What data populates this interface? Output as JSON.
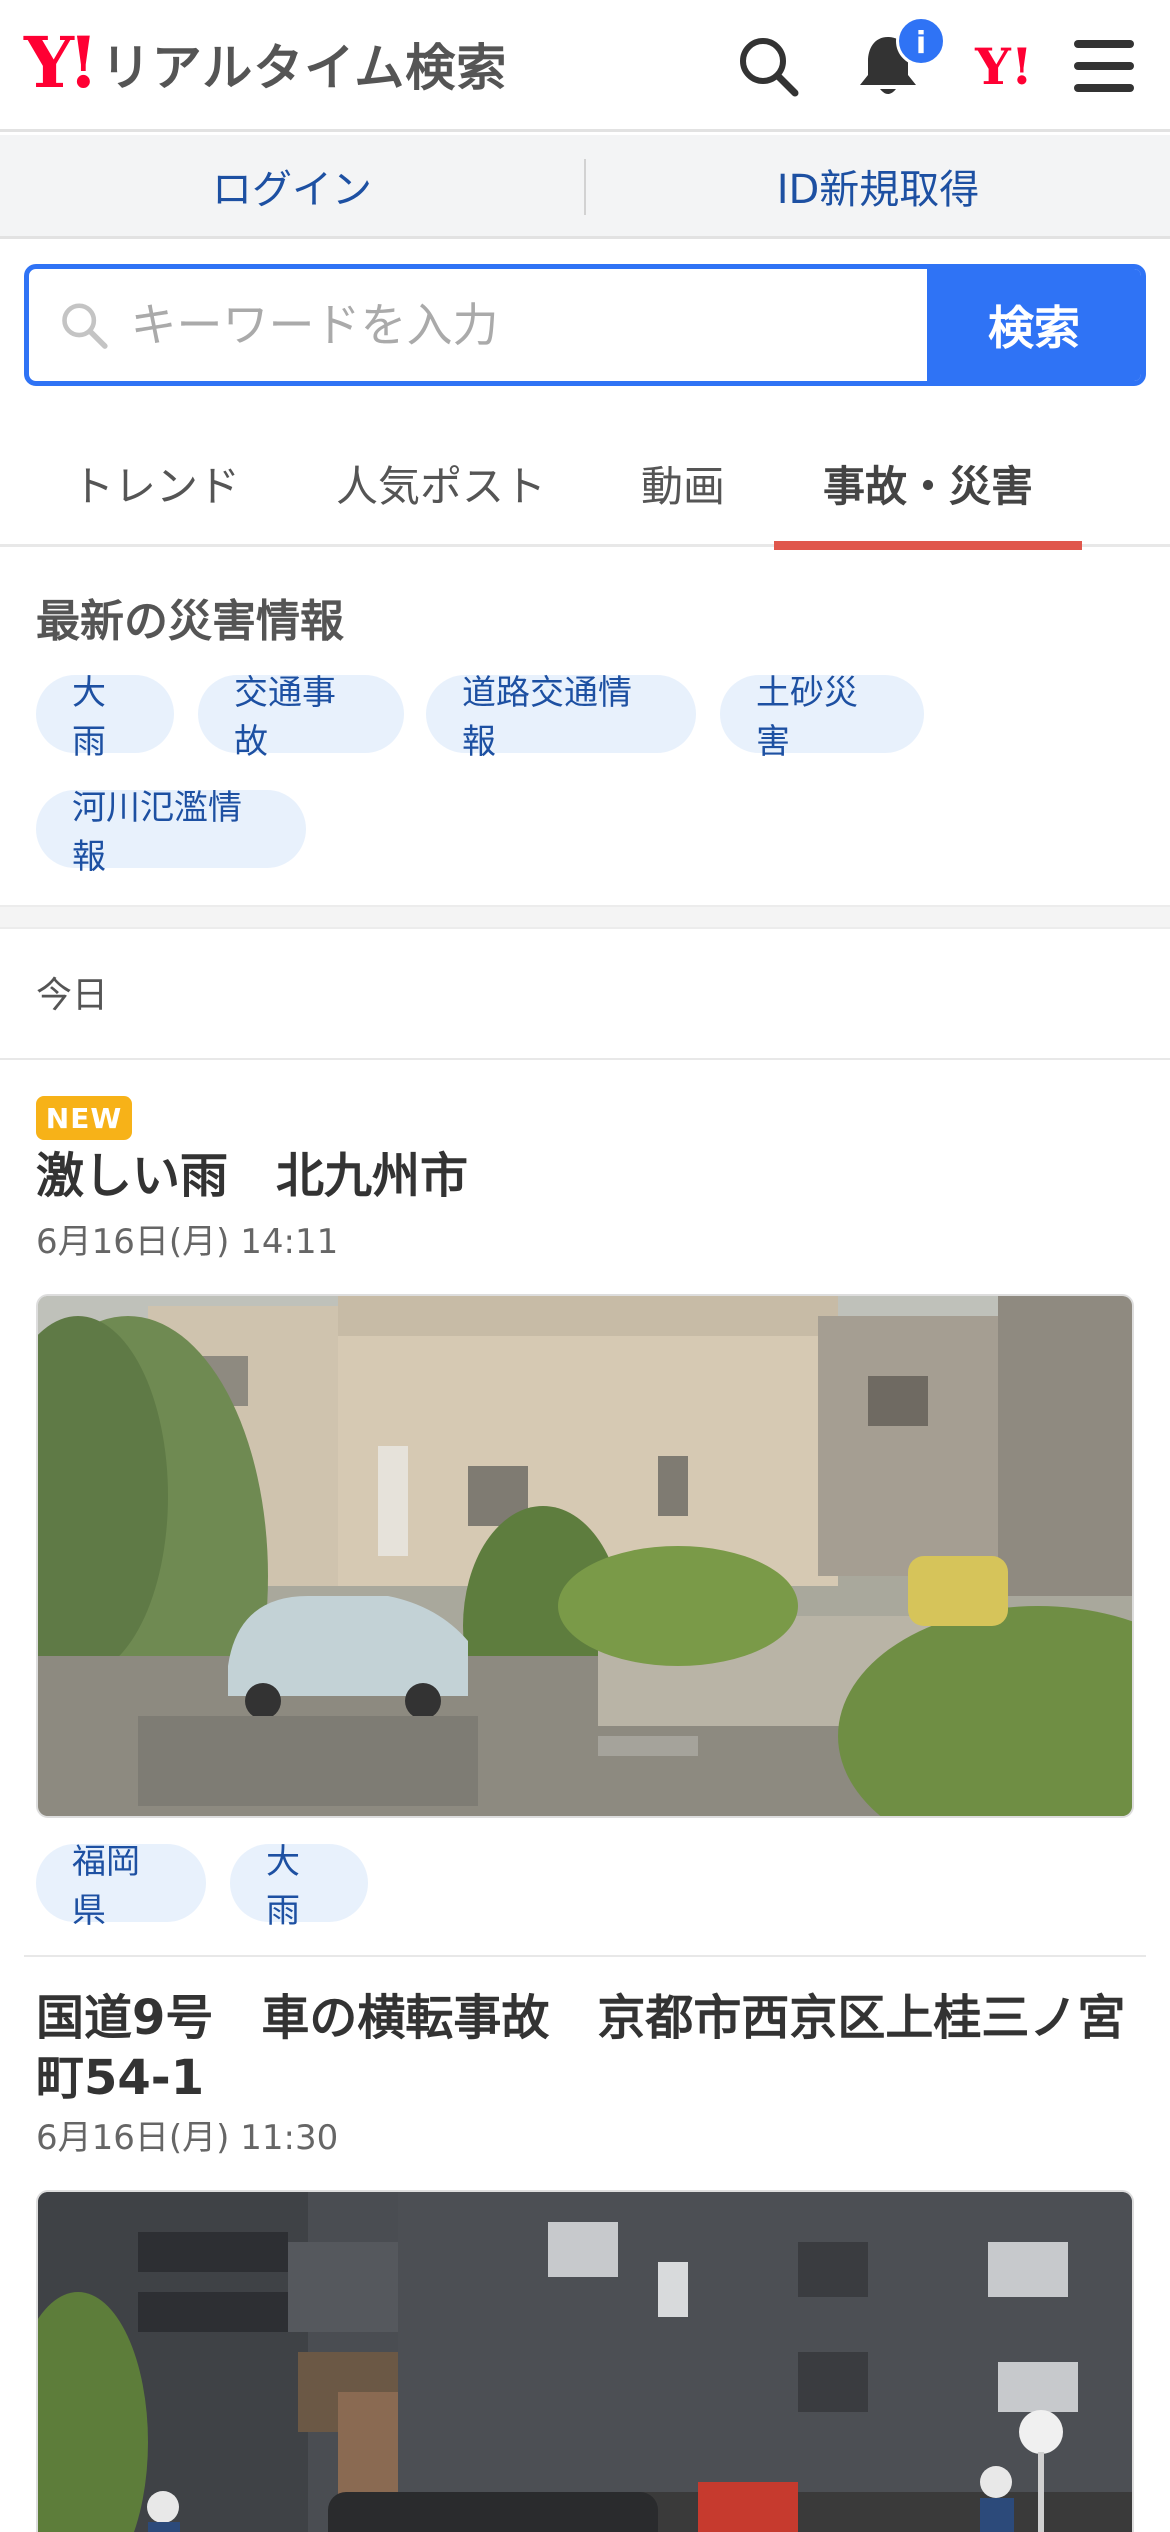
{
  "header": {
    "logo_mark": "Y!",
    "logo_text": "リアルタイム検索",
    "notification_badge": "i",
    "yahoo_mark": "Y!"
  },
  "auth": {
    "login": "ログイン",
    "signup": "ID新規取得"
  },
  "search": {
    "placeholder": "キーワードを入力",
    "button": "検索"
  },
  "tabs": [
    {
      "label": "トレンド",
      "active": false
    },
    {
      "label": "人気ポスト",
      "active": false
    },
    {
      "label": "動画",
      "active": false
    },
    {
      "label": "事故・災害",
      "active": true
    }
  ],
  "disaster": {
    "title": "最新の災害情報",
    "tags": [
      "大雨",
      "交通事故",
      "道路交通情報",
      "土砂災害",
      "河川氾濫情報"
    ]
  },
  "feed": {
    "day_label": "今日",
    "posts": [
      {
        "badge": "NEW",
        "title": "激しい雨　北九州市",
        "date": "6月16日(月) 14:11",
        "tags": [
          "福岡県",
          "大雨"
        ]
      },
      {
        "title": "国道9号　車の横転事故　京都市西京区上桂三ノ宮町54-1",
        "date": "6月16日(月) 11:30"
      }
    ]
  },
  "colors": {
    "brand_red": "#ff0033",
    "primary_blue": "#2f73f5",
    "link_blue": "#1d50a2",
    "active_tab_underline": "#e0574c",
    "new_badge": "#f7b218"
  }
}
